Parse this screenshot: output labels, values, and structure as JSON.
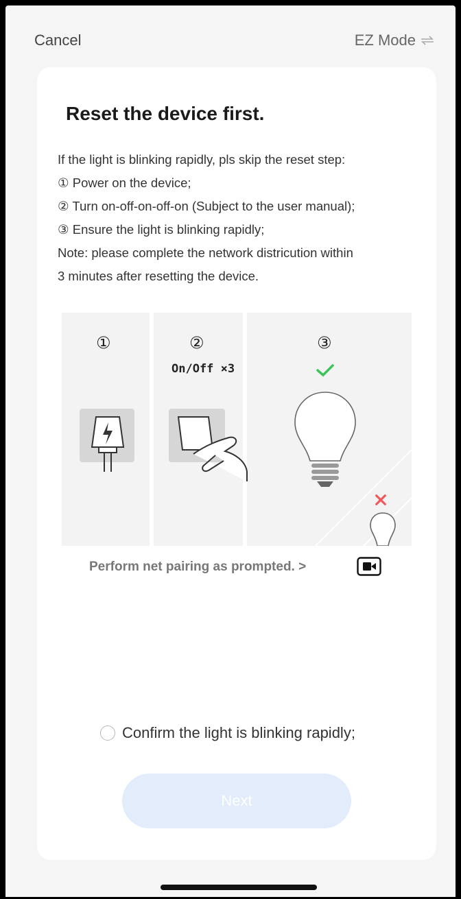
{
  "header": {
    "cancel_label": "Cancel",
    "mode_label": "EZ Mode"
  },
  "card": {
    "title": "Reset the device first.",
    "instructions": [
      "If the light is blinking rapidly, pls skip the reset step:",
      "① Power on the device;",
      "② Turn on-off-on-off-on (Subject to the user manual);",
      "③ Ensure the light is blinking rapidly;",
      "Note: please complete the network districution within",
      "3 minutes after resetting the device."
    ],
    "illustration": {
      "step1_number": "①",
      "step2_number": "②",
      "step2_caption": "On/Off ×3",
      "step3_number": "③"
    },
    "pair_link": "Perform net pairing as prompted. >",
    "confirm_label": "Confirm the light is blinking rapidly;",
    "next_label": "Next"
  },
  "colors": {
    "accent_disabled": "#e3ecfb",
    "check_green": "#3cc45a",
    "cross_red": "#f0575a"
  },
  "icons": {
    "mode_switch": "swap-arrows-icon",
    "video": "video-camera-icon",
    "plug": "power-plug-icon",
    "switch": "wall-switch-icon",
    "bulb": "light-bulb-icon"
  }
}
